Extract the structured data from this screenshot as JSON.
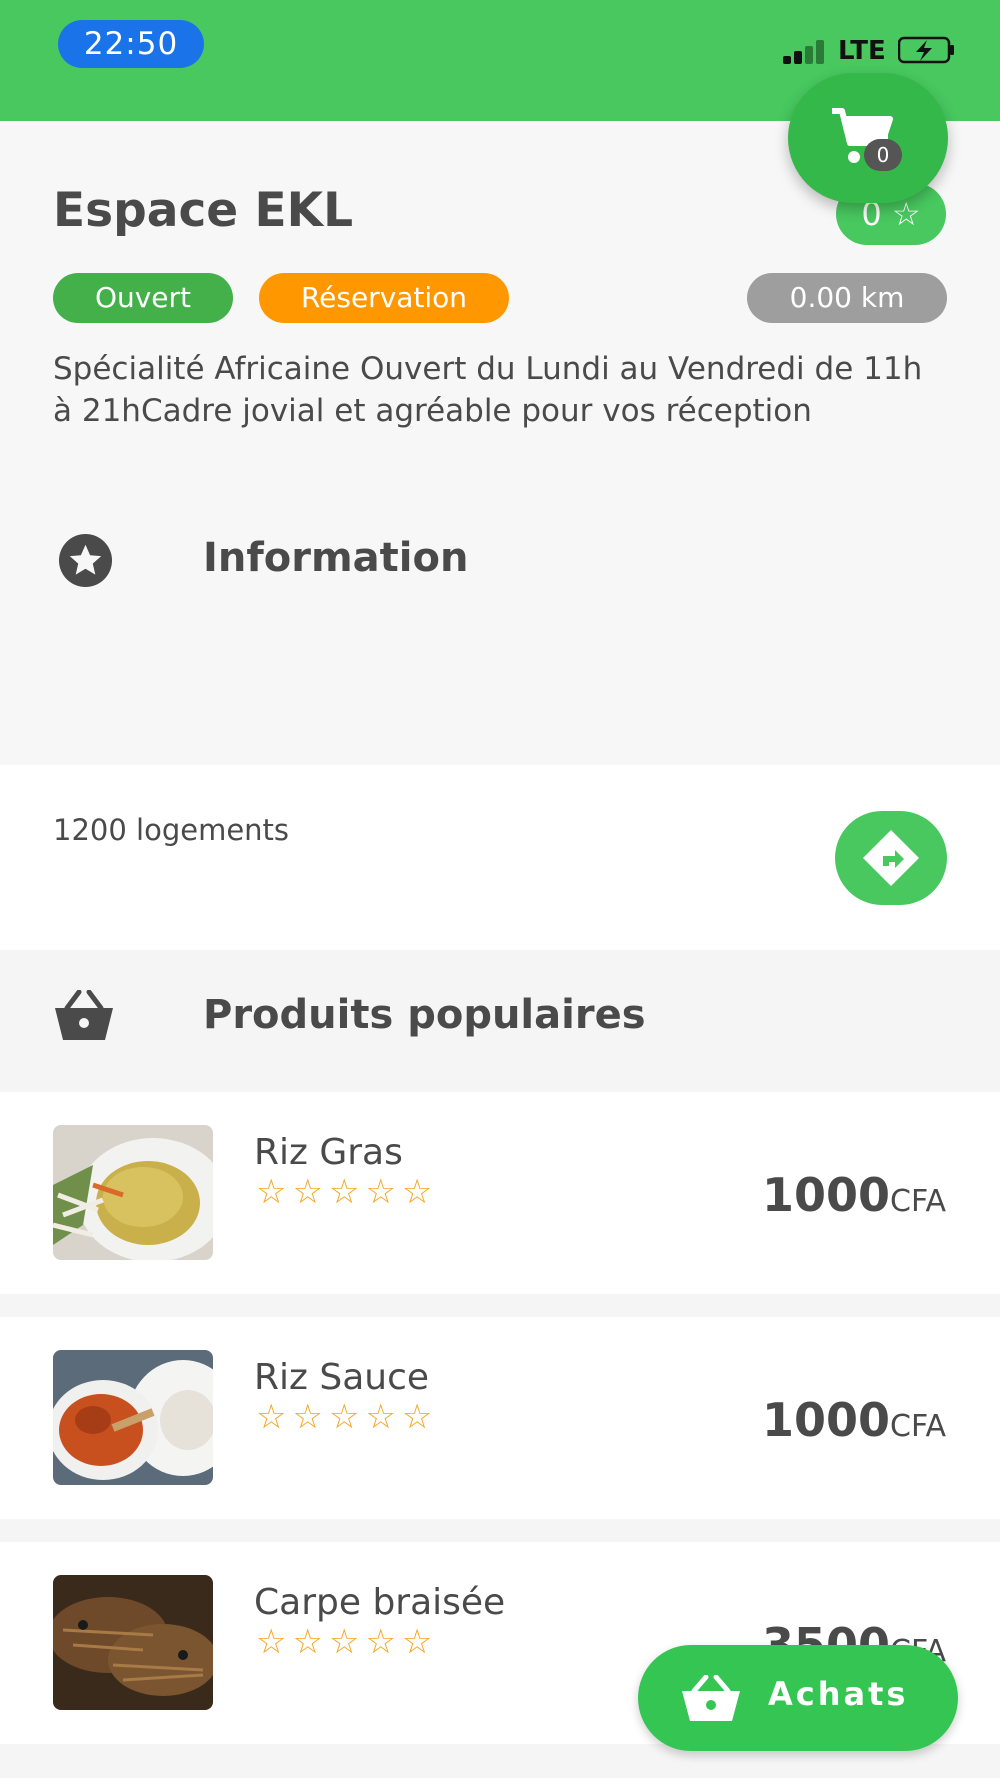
{
  "status_bar": {
    "time": "22:50",
    "network": "LTE"
  },
  "cart": {
    "count": "0"
  },
  "store": {
    "name": "Espace EKL",
    "rating": "0 ☆",
    "tags": {
      "open": "Ouvert",
      "reservation": "Réservation",
      "distance": "0.00 km"
    },
    "description": "Spécialité Africaine Ouvert du Lundi au Vendredi de 11h à 21hCadre jovial et agréable pour vos réception"
  },
  "information": {
    "title": "Information",
    "icon": "star-circle-icon"
  },
  "logement": {
    "text": "1200 logements"
  },
  "popular": {
    "title": "Produits populaires",
    "icon": "basket-icon",
    "products": [
      {
        "name": "Riz Gras",
        "stars": "☆☆☆☆☆",
        "price": "1000",
        "currency": "CFA"
      },
      {
        "name": "Riz Sauce",
        "stars": "☆☆☆☆☆",
        "price": "1000",
        "currency": "CFA"
      },
      {
        "name": "Carpe braisée",
        "stars": "☆☆☆☆☆",
        "price": "3500",
        "currency": "CFA"
      }
    ]
  },
  "achats_button": {
    "label": "Achats"
  },
  "colors": {
    "primary_green": "#48c85f",
    "open_green": "#43b04a",
    "reservation_orange": "#ff9800",
    "distance_grey": "#9e9e9e",
    "star_orange": "#f5a623",
    "time_pill_blue": "#1a73e8"
  }
}
